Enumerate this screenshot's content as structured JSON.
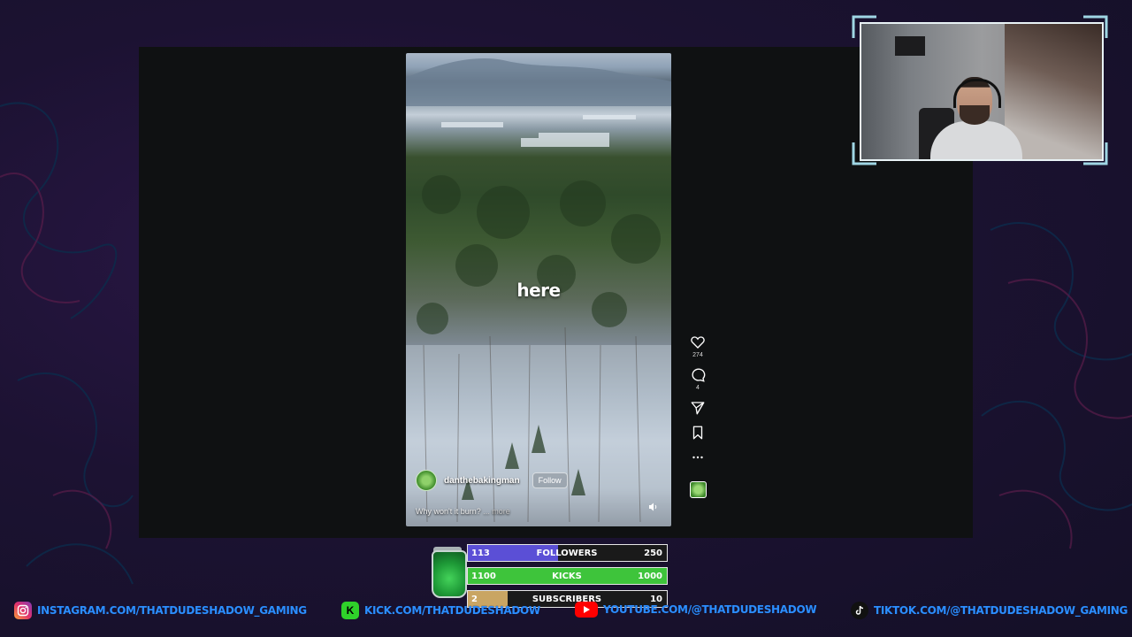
{
  "video": {
    "caption": "here",
    "author": "danthebakingman",
    "follow_label": "Follow",
    "description": "Why won't it burn?",
    "more_label": "... more"
  },
  "actions": {
    "likes": "274",
    "comments": "4"
  },
  "stats": {
    "followers": {
      "current": "113",
      "label": "FOLLOWERS",
      "goal": "250",
      "progress": 0.452,
      "color": "#5b4fd6"
    },
    "kicks": {
      "current": "1100",
      "label": "KICKS",
      "goal": "1000",
      "progress": 1.0,
      "color": "#3ec43b"
    },
    "subscribers": {
      "current": "2",
      "label": "SUBSCRIBERS",
      "goal": "10",
      "progress": 0.2,
      "color": "#c9a563"
    }
  },
  "socials": {
    "instagram": "INSTAGRAM.COM/THATDUDESHADOW_GAMING",
    "kick": "KICK.COM/THATDUDESHADOW",
    "youtube": "YOUTUBE.COM/@THATDUDESHADOW",
    "tiktok": "TIKTOK.COM/@THATDUDESHADOW_GAMING"
  },
  "colors": {
    "background": "#1c1232",
    "social_text": "#2c8eff",
    "webcam_frame": "#9fd6e4"
  },
  "icons": {
    "like": "heart-icon",
    "comment": "comment-icon",
    "share": "send-icon",
    "save": "bookmark-icon",
    "more": "more-icon"
  }
}
